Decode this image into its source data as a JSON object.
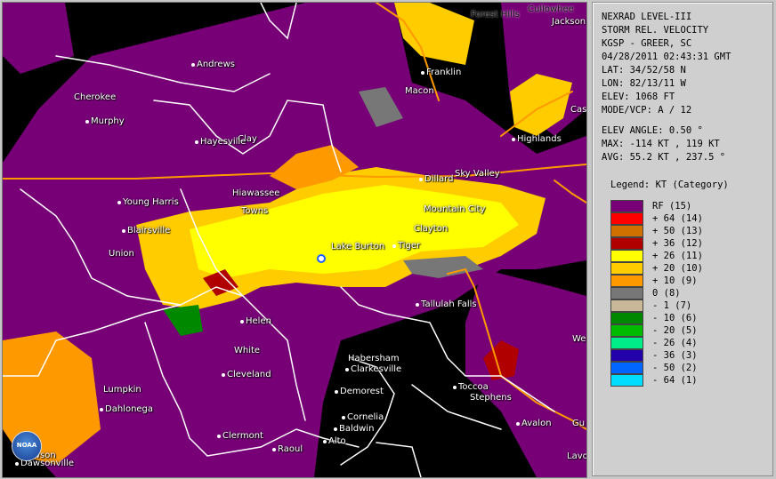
{
  "map": {
    "places": [
      {
        "name": "Forest Hills"
      },
      {
        "name": "Cullowhee"
      },
      {
        "name": "Jackson"
      },
      {
        "name": "Andrews"
      },
      {
        "name": "Franklin"
      },
      {
        "name": "Cherokee"
      },
      {
        "name": "Macon"
      },
      {
        "name": "Murphy"
      },
      {
        "name": "Cas"
      },
      {
        "name": "Highlands"
      },
      {
        "name": "Clay"
      },
      {
        "name": "Hayesville"
      },
      {
        "name": "Sky Valley"
      },
      {
        "name": "Dillard"
      },
      {
        "name": "Hiawassee"
      },
      {
        "name": "Young Harris"
      },
      {
        "name": "Towns"
      },
      {
        "name": "Mountain City"
      },
      {
        "name": "Clayton"
      },
      {
        "name": "Blairsville"
      },
      {
        "name": "Lake Burton"
      },
      {
        "name": "Tiger"
      },
      {
        "name": "Union"
      },
      {
        "name": "Tallulah Falls"
      },
      {
        "name": "Helen"
      },
      {
        "name": "We"
      },
      {
        "name": "White"
      },
      {
        "name": "Habersham"
      },
      {
        "name": "Clarkesville"
      },
      {
        "name": "Cleveland"
      },
      {
        "name": "Lumpkin"
      },
      {
        "name": "Toccoa"
      },
      {
        "name": "Demorest"
      },
      {
        "name": "Stephens"
      },
      {
        "name": "Dahlonega"
      },
      {
        "name": "Cornelia"
      },
      {
        "name": "Avalon"
      },
      {
        "name": "Gu"
      },
      {
        "name": "Baldwin"
      },
      {
        "name": "Clermont"
      },
      {
        "name": "Alto"
      },
      {
        "name": "Raoul"
      },
      {
        "name": "Dawson"
      },
      {
        "name": "Dawsonville"
      },
      {
        "name": "Lavo"
      }
    ],
    "logo_text": "NOAA"
  },
  "info": {
    "product": "NEXRAD LEVEL-III",
    "type": "STORM REL. VELOCITY",
    "station": "KGSP - GREER, SC",
    "datetime": "04/28/2011 02:43:31 GMT",
    "lat": "LAT: 34/52/58 N",
    "lon": "LON: 82/13/11 W",
    "elev": "ELEV: 1068 FT",
    "mode": "MODE/VCP: A / 12",
    "elev_angle": "ELEV ANGLE: 0.50 °",
    "max": "MAX: -114 KT , 119 KT",
    "avg": "AVG: 55.2 KT , 237.5 °"
  },
  "legend": {
    "title": "Legend: KT (Category)",
    "items": [
      {
        "label": "RF  (15)",
        "color": "#770077"
      },
      {
        "label": "+ 64  (14)",
        "color": "#ff0000"
      },
      {
        "label": "+ 50  (13)",
        "color": "#d07000"
      },
      {
        "label": "+ 36  (12)",
        "color": "#b00000"
      },
      {
        "label": "+ 26  (11)",
        "color": "#ffff00"
      },
      {
        "label": "+ 20  (10)",
        "color": "#ffcc00"
      },
      {
        "label": "+ 10  (9)",
        "color": "#ff9900"
      },
      {
        "label": "0  (8)",
        "color": "#777777"
      },
      {
        "label": "- 1  (7)",
        "color": "#c8b898"
      },
      {
        "label": "- 10  (6)",
        "color": "#008800"
      },
      {
        "label": "- 20  (5)",
        "color": "#00bb00"
      },
      {
        "label": "- 26  (4)",
        "color": "#00ee88"
      },
      {
        "label": "- 36  (3)",
        "color": "#2200aa"
      },
      {
        "label": "- 50  (2)",
        "color": "#0066ff"
      },
      {
        "label": "- 64  (1)",
        "color": "#00ddff"
      }
    ]
  }
}
